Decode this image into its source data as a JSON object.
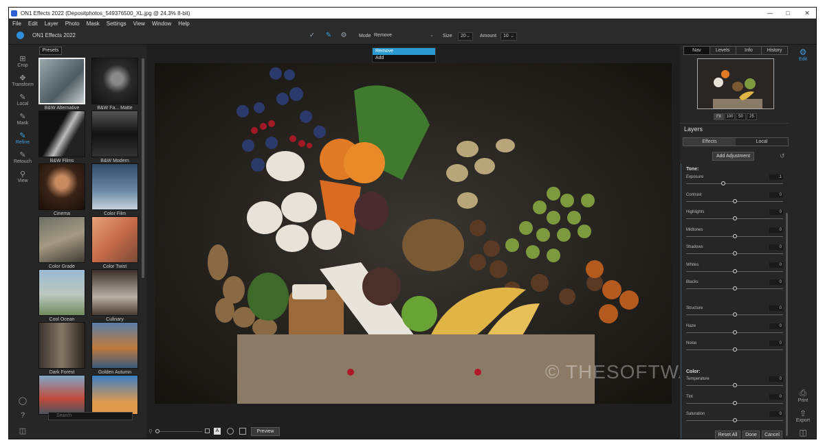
{
  "window": {
    "title": "ON1 Effects 2022 (Depositphotos_549376500_XL.jpg @ 24.3% 8-bit)"
  },
  "menu": [
    "File",
    "Edit",
    "Layer",
    "Photo",
    "Mask",
    "Settings",
    "View",
    "Window",
    "Help"
  ],
  "topbar": {
    "brand": "ON1 Effects 2022",
    "mode_label": "Mode",
    "mode_value": "Remove",
    "mode_options": [
      "Remove",
      "Add"
    ],
    "size_label": "Size",
    "size_value": "20",
    "amount_label": "Amount",
    "amount_value": "10"
  },
  "tools": [
    {
      "label": "Crop",
      "icon": "crop-icon"
    },
    {
      "label": "Transform",
      "icon": "transform-icon"
    },
    {
      "label": "Local",
      "icon": "brush-icon"
    },
    {
      "label": "Mask",
      "icon": "mask-icon"
    },
    {
      "label": "Refine",
      "icon": "refine-icon"
    },
    {
      "label": "Retouch",
      "icon": "retouch-icon"
    },
    {
      "label": "View",
      "icon": "zoom-icon"
    }
  ],
  "presets": {
    "button": "Presets",
    "items": [
      "B&W Alternative",
      "B&W Fa... Matte",
      "B&W Films",
      "B&W Modern",
      "Cinema",
      "Color Film",
      "Color Grade",
      "Color Twist",
      "Cool Ocean",
      "Culinary",
      "Dark Forest",
      "Golden Autumn"
    ],
    "search_placeholder": "Search"
  },
  "bottom": {
    "preview": "Preview",
    "a_label": "A"
  },
  "right_tabs": [
    "Nav",
    "Levels",
    "Info",
    "History"
  ],
  "zoom": [
    "Fit",
    "100",
    "50",
    "25"
  ],
  "layers": {
    "title": "Layers",
    "tabs": [
      "Effects",
      "Local"
    ],
    "add_adjustment": "Add Adjustment"
  },
  "tone": {
    "title": "Tone:",
    "sliders": [
      {
        "label": "Exposure",
        "value": ".1",
        "pos": 0.38
      },
      {
        "label": "Contrast",
        "value": "0",
        "pos": 0.5
      },
      {
        "label": "Highlights",
        "value": "0",
        "pos": 0.5
      },
      {
        "label": "Midtones",
        "value": "0",
        "pos": 0.5
      },
      {
        "label": "Shadows",
        "value": "0",
        "pos": 0.5
      },
      {
        "label": "Whites",
        "value": "0",
        "pos": 0.5
      },
      {
        "label": "Blacks",
        "value": "0",
        "pos": 0.5
      },
      {
        "label": "Structure",
        "value": "0",
        "pos": 0.5
      },
      {
        "label": "Haze",
        "value": "0",
        "pos": 0.5
      },
      {
        "label": "Noise",
        "value": "0",
        "pos": 0.5
      }
    ]
  },
  "color": {
    "title": "Color:",
    "sliders": [
      {
        "label": "Temperature",
        "value": "0",
        "pos": 0.5
      },
      {
        "label": "Tint",
        "value": "0",
        "pos": 0.5
      },
      {
        "label": "Saturation",
        "value": "0",
        "pos": 0.5
      }
    ]
  },
  "rside": {
    "edit": "Edit",
    "print": "Print",
    "export": "Export"
  },
  "footer_buttons": {
    "reset": "Reset All",
    "done": "Done",
    "cancel": "Cancel"
  },
  "watermark": "© THESOFTWARE.SHOP"
}
